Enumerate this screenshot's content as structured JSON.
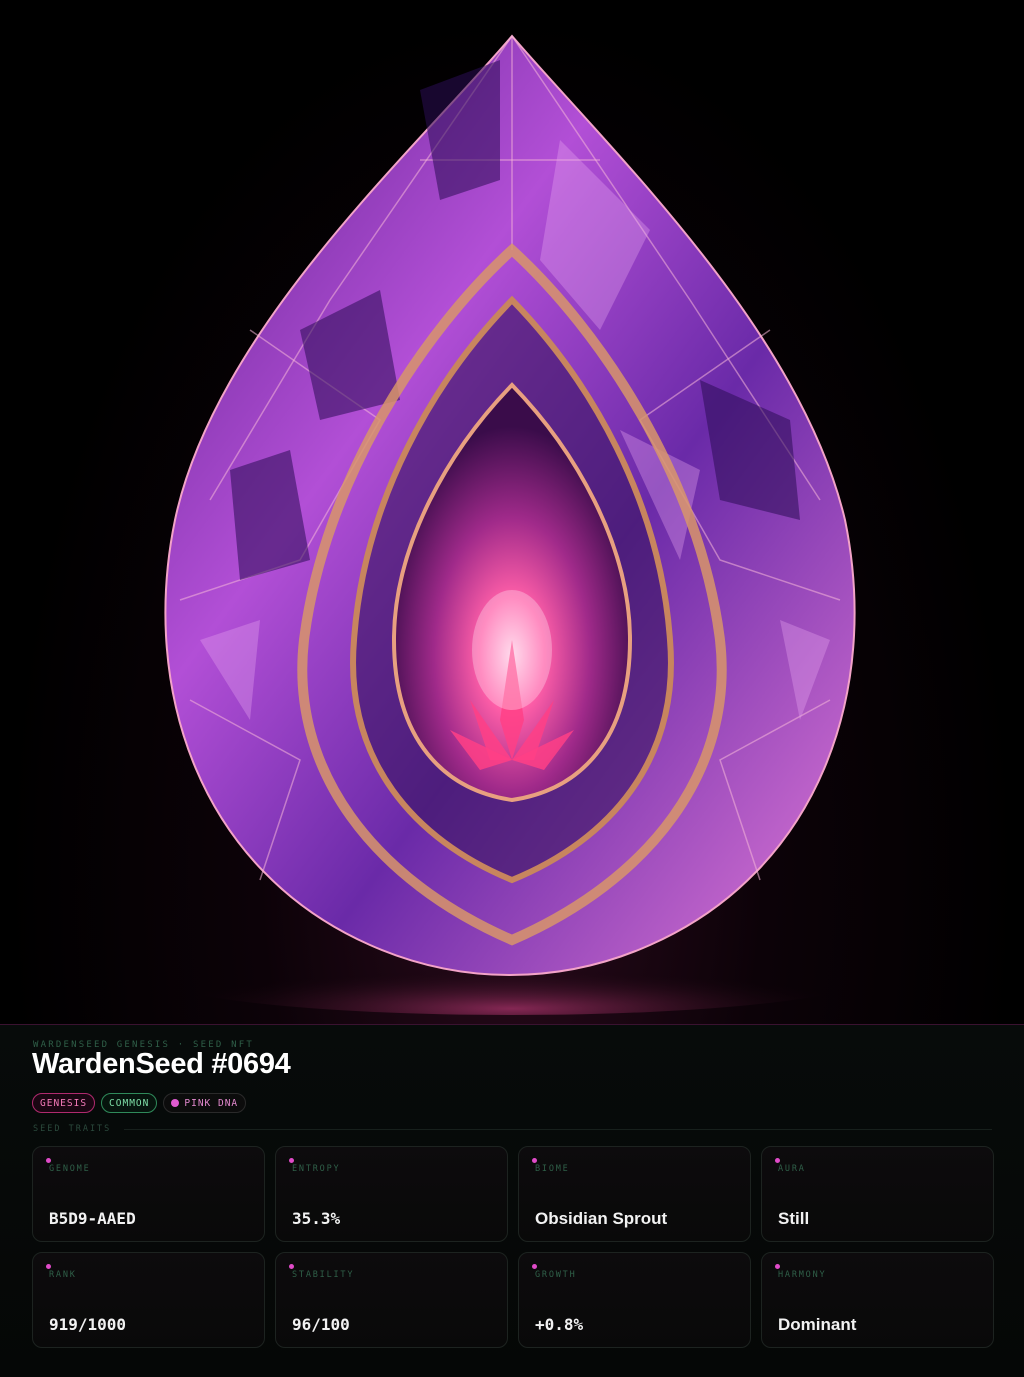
{
  "collection_label": "WARDENSEED GENESIS · SEED NFT",
  "title": "WardenSeed #0694",
  "badges": {
    "genesis": "GENESIS",
    "rarity": "COMMON",
    "dna": "PINK DNA"
  },
  "traits_label": "SEED TRAITS",
  "traits": [
    {
      "label": "GENOME",
      "value": "B5D9-AAED"
    },
    {
      "label": "ENTROPY",
      "value": "35.3%"
    },
    {
      "label": "BIOME",
      "value": "Obsidian Sprout"
    },
    {
      "label": "AURA",
      "value": "Still"
    },
    {
      "label": "RANK",
      "value": "919/1000"
    },
    {
      "label": "STABILITY",
      "value": "96/100"
    },
    {
      "label": "GROWTH",
      "value": "+0.8%"
    },
    {
      "label": "HARMONY",
      "value": "Dominant"
    }
  ],
  "colors": {
    "accent_pink": "#e04bc8",
    "rarity_green": "#7fe0a8",
    "label_green": "#2f5f48"
  }
}
